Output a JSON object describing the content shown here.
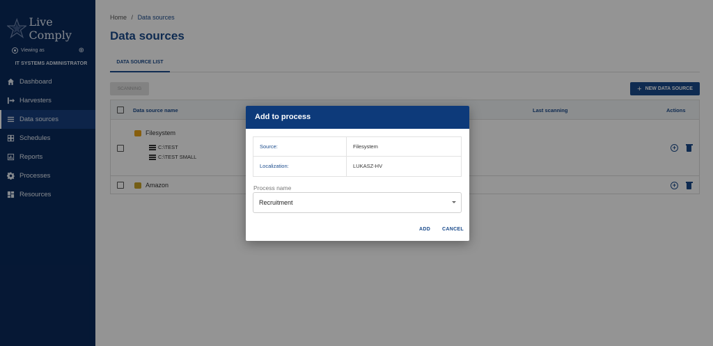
{
  "app": {
    "name": "Live Comply"
  },
  "sidebar": {
    "viewing_as": "Viewing as",
    "role": "IT SYSTEMS ADMINISTRATOR",
    "items": [
      {
        "label": "Dashboard",
        "icon": "home-icon"
      },
      {
        "label": "Harvesters",
        "icon": "harvester-icon"
      },
      {
        "label": "Data sources",
        "icon": "list-icon",
        "active": true
      },
      {
        "label": "Schedules",
        "icon": "calendar-grid-icon"
      },
      {
        "label": "Reports",
        "icon": "chart-icon"
      },
      {
        "label": "Processes",
        "icon": "gear-icon"
      },
      {
        "label": "Resources",
        "icon": "dashboard-icon"
      }
    ]
  },
  "breadcrumb": {
    "home": "Home",
    "separator": "/",
    "current": "Data sources"
  },
  "page": {
    "title": "Data sources"
  },
  "tabs": [
    {
      "label": "DATA SOURCE LIST"
    }
  ],
  "toolbar": {
    "scanning_label": "SCANNING",
    "new_label": "NEW DATA SOURCE"
  },
  "table": {
    "headers": {
      "name": "Data source name",
      "last_scanning": "Last scanning",
      "actions": "Actions"
    },
    "rows": [
      {
        "name": "Filesystem",
        "children": [
          "C:\\TEST",
          "C:\\TEST SMALL"
        ],
        "icon_color": "#e8a317"
      },
      {
        "name": "Amazon",
        "icon_color": "#e8a317"
      }
    ]
  },
  "dialog": {
    "title": "Add to process",
    "source_label": "Source:",
    "source_value": "Filesystem",
    "localization_label": "Localization:",
    "localization_value": "LUKASZ-HV",
    "process_name_label": "Process name",
    "process_name_value": "Recruitment",
    "add_label": "ADD",
    "cancel_label": "CANCEL"
  },
  "colors": {
    "primary": "#0d3a7a",
    "sidebar": "#0a2a5c",
    "accent": "#1a4b8c"
  }
}
